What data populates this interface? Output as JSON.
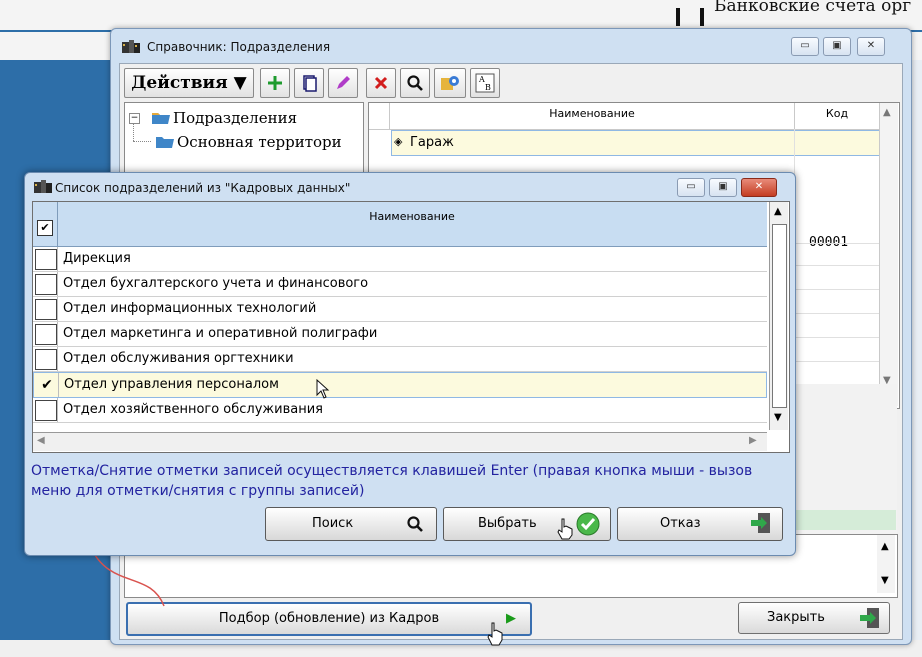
{
  "background_window": {
    "partial_title": "Банковские счета орг"
  },
  "main_window": {
    "title": "Справочник: Подразделения",
    "toolbar": {
      "actions_label": "Действия ▼",
      "icons": [
        "add-icon",
        "copy-icon",
        "edit-icon",
        "delete-icon",
        "search-icon",
        "refresh-icon",
        "sort-icon"
      ]
    },
    "tree": {
      "root_label": "Подразделения",
      "child_label": "Основная территори"
    },
    "grid": {
      "columns": [
        "Наименование",
        "Код"
      ],
      "rows": [
        {
          "name": "Гараж",
          "code": ""
        },
        {
          "name": "",
          "code": "00001"
        }
      ]
    },
    "buttons": {
      "import_label": "Подбор (обновление) из Кадров",
      "close_label": "Закрыть"
    }
  },
  "dialog": {
    "title": "Список подразделений из \"Кадровых данных\"",
    "column_header": "Наименование",
    "rows": [
      {
        "label": "Дирекция",
        "checked": false
      },
      {
        "label": "Отдел бухгалтерского учета и финансового",
        "checked": false
      },
      {
        "label": "Отдел информационных технологий",
        "checked": false
      },
      {
        "label": "Отдел маркетинга и оперативной полиграфи",
        "checked": false
      },
      {
        "label": "Отдел обслуживания оргтехники",
        "checked": false
      },
      {
        "label": "Отдел управления персоналом",
        "checked": true
      },
      {
        "label": "Отдел хозяйственного обслуживания",
        "checked": false
      }
    ],
    "note": "Отметка/Снятие отметки записей осуществляется клавишей Enter (правая кнопка мыши - вызов меню для отметки/снятия с группы записей)",
    "buttons": {
      "search_label": "Поиск",
      "select_label": "Выбрать",
      "cancel_label": "Отказ"
    }
  },
  "colors": {
    "window_frame": "#cfe0f2",
    "highlight_row": "#fcfade",
    "note_text": "#2323a0",
    "annotation_arrow": "#d9534f"
  }
}
